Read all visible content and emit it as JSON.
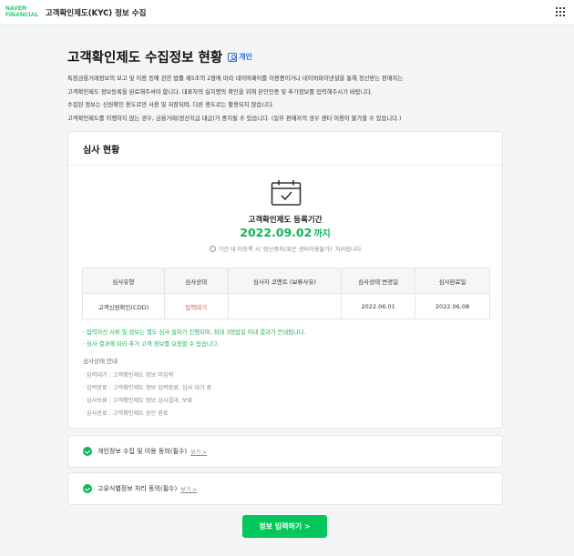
{
  "header": {
    "logo_line1": "NAVER",
    "logo_line2": "FINANCIAL",
    "title": "고객확인제도(KYC) 정보 수집",
    "menu_icon": "grid-icon"
  },
  "page": {
    "title": "고객확인제도 수집정보 현황",
    "badge_label": "개인",
    "intro": [
      "특정금융거래정보의 보고 및 이용 등에 관한 법률 제5조의 2항에 따라 네이버페이를 이용중이거나 네이버파이낸셜을 통해 정산받는 판매자는",
      "고객확인제도 정보등록을 완료해주셔야 합니다. 대표자의 실지명의 확인을 위해 본인인증 및 추가정보를 입력해주시기 바랍니다.",
      "수집된 정보는 신원확인 용도로만 사용 및 저장되며, 다른 용도로는 활용되지 않습니다.",
      "고객확인제도를 이행하지 않는 경우, 금융거래(정산지급 대급)가 중지될 수 있습니다. (일부 판매자의 경우 센터 이용이 불가할 수 있습니다.)"
    ]
  },
  "review": {
    "heading": "심사 현황",
    "period_label": "고객확인제도 등록기간",
    "period_date": "2022.09.02",
    "period_suffix": "까지",
    "period_note": "기간 내 미등록 시 '정산중지(혹은 센터이용불가)' 처리됩니다",
    "table": {
      "headers": [
        "심사유형",
        "심사상태",
        "심사자 코멘트 (보류사유)",
        "심사상태 변경일",
        "심사완료일"
      ],
      "row": [
        "고객신원확인(CDD)",
        "입력대기",
        "",
        "2022.06.01",
        "2022.06.08"
      ]
    },
    "notes": [
      "· 입력하신 서류 및 정보는 별도 심사 절차가 진행되며, 최대 3영업일 이내 결과가 안내됩니다.",
      "· 심사 결과에 따라 추가 고객 정보를 요청할 수 있습니다."
    ],
    "guide_title": "심사상태 안내",
    "guide": [
      "· 입력대기 : 고객확인제도 정보 미입력",
      "· 입력완료 : 고객확인제도 정보 입력완료, 심사 대기 중",
      "· 심사보류 : 고객확인제도 정보 심사결과, 보류",
      "· 심사완료 : 고객확인제도 승인 완료"
    ],
    "accent": "#10b55a",
    "status_color": "#e54c4c"
  },
  "agreements": [
    {
      "label": "개인정보 수집 및 이용 동의(필수)",
      "link": "보기 >"
    },
    {
      "label": "고유식별정보 처리 동의(필수)",
      "link": "보기 >"
    }
  ],
  "submit_label": "정보 입력하기 >",
  "brand_color": "#03c75a"
}
